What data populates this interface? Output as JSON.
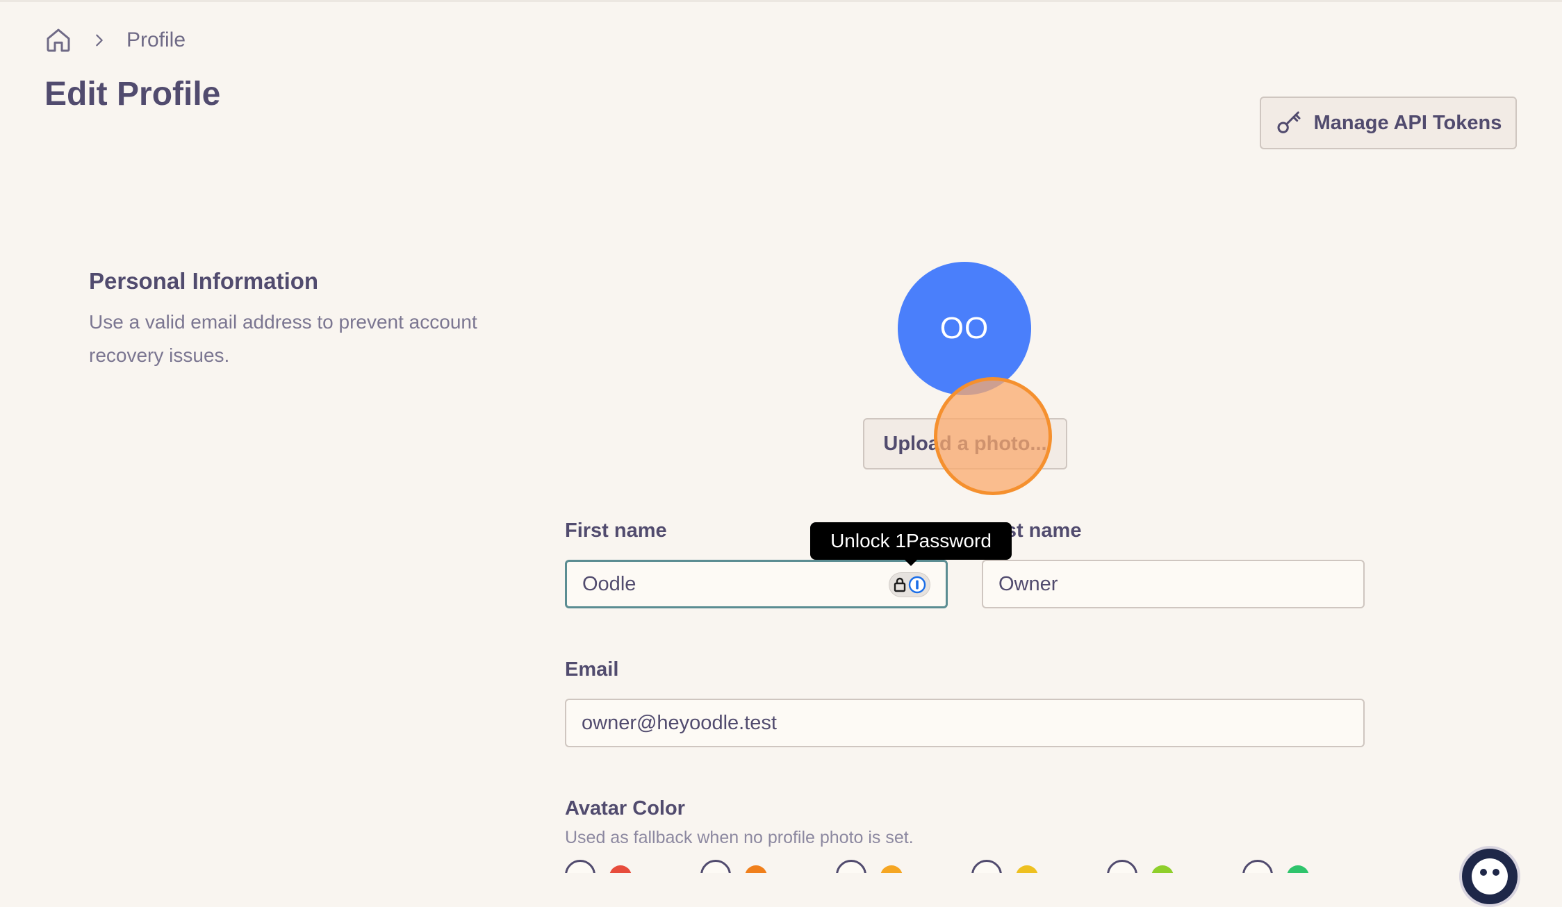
{
  "breadcrumb": {
    "current": "Profile"
  },
  "page": {
    "title": "Edit Profile"
  },
  "header": {
    "api_tokens_label": "Manage API Tokens"
  },
  "personal_info": {
    "title": "Personal Information",
    "description": "Use a valid email address to prevent account recovery issues."
  },
  "avatar": {
    "initials": "OO",
    "color": "#4a7ffb",
    "upload_label": "Upload a photo..."
  },
  "form": {
    "first_name_label": "First name",
    "first_name_value": "Oodle",
    "last_name_label": "Last name",
    "last_name_value": "Owner",
    "email_label": "Email",
    "email_value": "owner@heyoodle.test",
    "avatar_color_label": "Avatar Color",
    "avatar_color_hint": "Used as fallback when no profile photo is set."
  },
  "password_manager": {
    "tooltip": "Unlock 1Password",
    "icons": [
      "lock-icon",
      "onepassword-icon"
    ]
  },
  "avatar_colors": [
    {
      "name": "red",
      "hex": "#e74c3c"
    },
    {
      "name": "orange",
      "hex": "#f07f1b"
    },
    {
      "name": "amber",
      "hex": "#f5a623"
    },
    {
      "name": "yellow",
      "hex": "#eec020"
    },
    {
      "name": "lime",
      "hex": "#8fcf2b"
    },
    {
      "name": "green",
      "hex": "#2fc46c"
    }
  ],
  "colors": {
    "background": "#f9f5f0",
    "text": "#514b6e",
    "focus_border": "#5b8d92",
    "click_marker": "#f5902e"
  }
}
